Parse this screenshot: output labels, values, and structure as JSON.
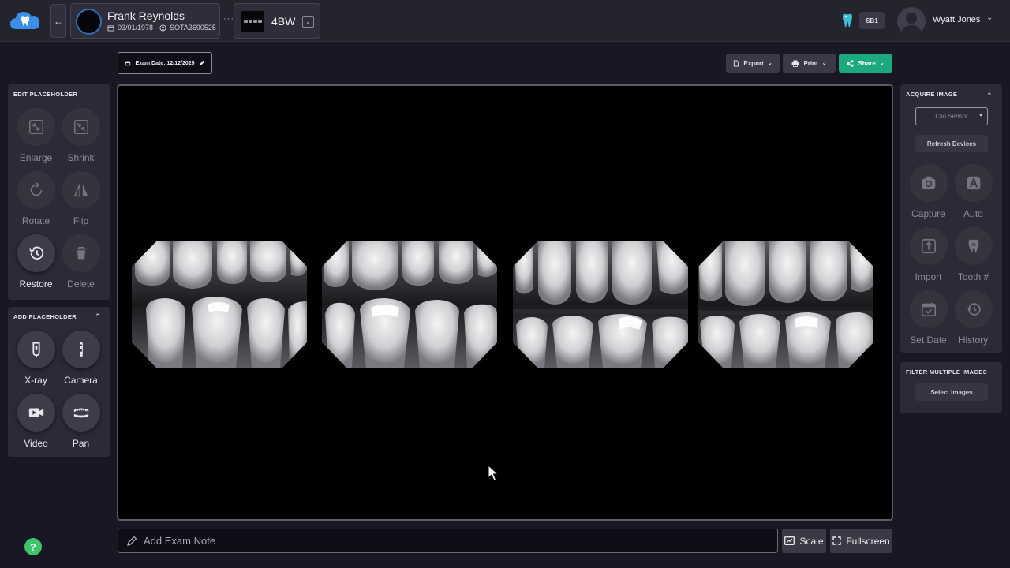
{
  "header": {
    "patient": {
      "name": "Frank Reynolds",
      "dob": "03/01/1978",
      "id": "SOTA3690525"
    },
    "exam": {
      "name": "4BW"
    },
    "location_badge": "SB1",
    "user": {
      "name": "Wyatt Jones"
    }
  },
  "toolbar": {
    "exam_date": "Exam Date: 12/12/2025",
    "export": "Export",
    "print": "Print",
    "share": "Share"
  },
  "edit_panel": {
    "title": "EDIT PLACEHOLDER",
    "tools": [
      {
        "label": "Enlarge",
        "icon": "enlarge-icon"
      },
      {
        "label": "Shrink",
        "icon": "shrink-icon"
      },
      {
        "label": "Rotate",
        "icon": "rotate-icon"
      },
      {
        "label": "Flip",
        "icon": "flip-icon"
      },
      {
        "label": "Restore",
        "icon": "restore-icon"
      },
      {
        "label": "Delete",
        "icon": "trash-icon"
      }
    ]
  },
  "add_panel": {
    "title": "ADD PLACEHOLDER",
    "tools": [
      {
        "label": "X-ray",
        "icon": "xray-sensor-icon"
      },
      {
        "label": "Camera",
        "icon": "intraoral-camera-icon"
      },
      {
        "label": "Video",
        "icon": "video-icon"
      },
      {
        "label": "Pan",
        "icon": "panoramic-icon"
      }
    ]
  },
  "acquire_panel": {
    "title": "ACQUIRE IMAGE",
    "sensor": "Clio Sensor",
    "refresh": "Refresh Devices",
    "tools": [
      {
        "label": "Capture",
        "icon": "camera-icon"
      },
      {
        "label": "Auto",
        "icon": "auto-icon"
      },
      {
        "label": "Import",
        "icon": "import-icon"
      },
      {
        "label": "Tooth #",
        "icon": "tooth-icon"
      },
      {
        "label": "Set Date",
        "icon": "calendar-icon"
      },
      {
        "label": "History",
        "icon": "history-icon"
      }
    ]
  },
  "filter_panel": {
    "title": "FILTER MULTIPLE IMAGES",
    "select": "Select Images"
  },
  "bottom": {
    "note_placeholder": "Add Exam Note",
    "scale": "Scale",
    "fullscreen": "Fullscreen",
    "help": "?"
  },
  "colors": {
    "accent": "#1da980",
    "background": "#181825",
    "panel": "#2b2b37",
    "help": "#3ec46a"
  }
}
